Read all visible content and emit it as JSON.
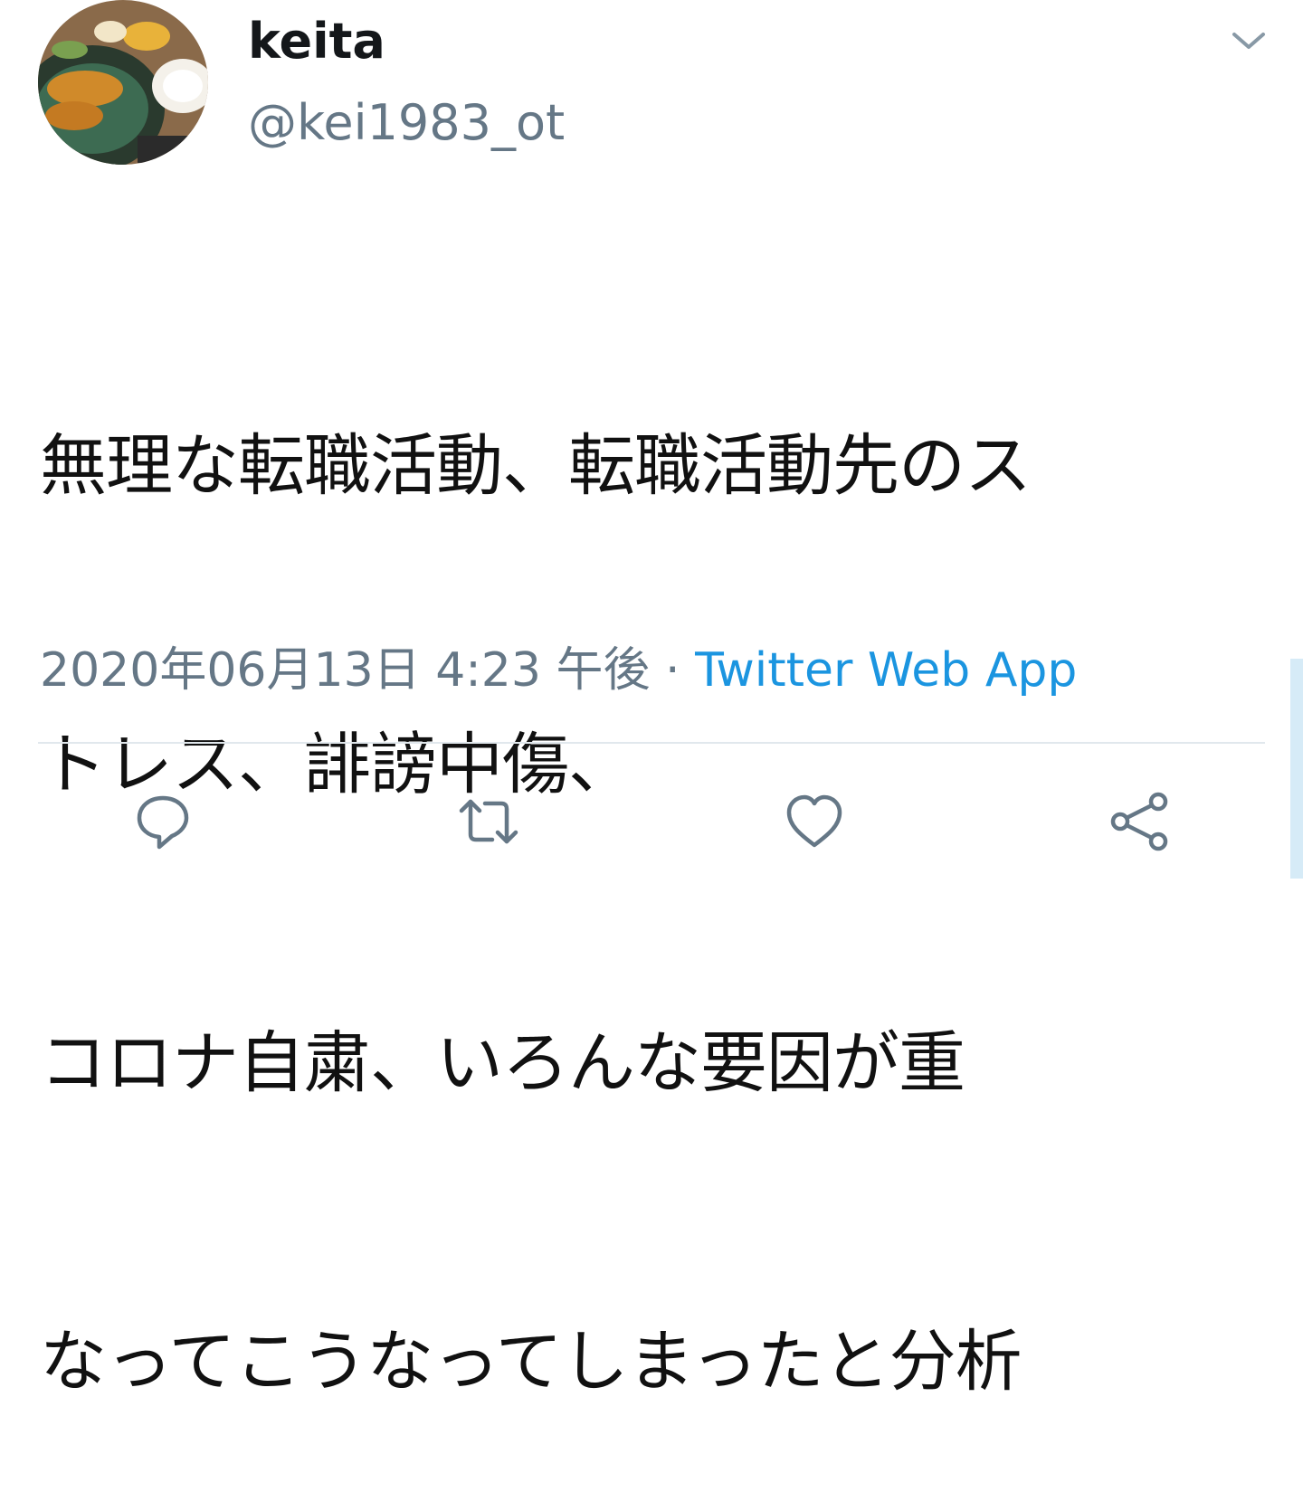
{
  "tweet": {
    "display_name": "keita",
    "handle": "@kei1983_ot",
    "text_lines": [
      "無理な転職活動、転職活動先のス",
      "トレス、誹謗中傷、",
      "コロナ自粛、いろんな要因が重",
      "なってこうなってしまったと分析"
    ],
    "timestamp": "2020年06月13日 4:23 午後",
    "separator": " · ",
    "source": "Twitter Web App"
  },
  "actions": [
    {
      "name": "reply",
      "icon": "reply-icon"
    },
    {
      "name": "retweet",
      "icon": "retweet-icon"
    },
    {
      "name": "like",
      "icon": "heart-icon"
    },
    {
      "name": "share",
      "icon": "share-icon"
    }
  ],
  "colors": {
    "name": "#14171a",
    "secondary": "#657786",
    "link": "#1b95e0",
    "divider": "#e1e8ed"
  }
}
